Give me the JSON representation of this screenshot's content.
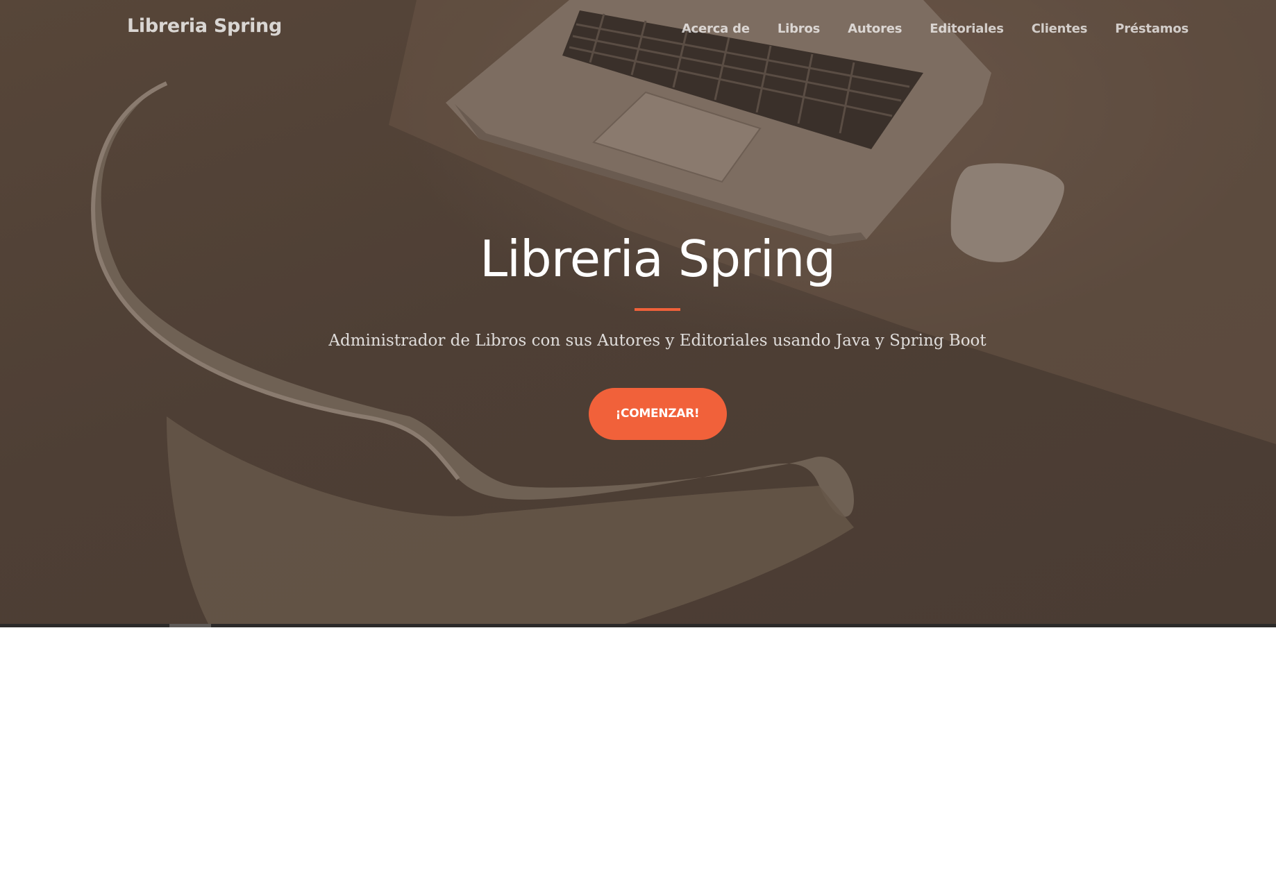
{
  "navbar": {
    "brand": "Libreria Spring",
    "links": [
      "Acerca de",
      "Libros",
      "Autores",
      "Editoriales",
      "Clientes",
      "Préstamos"
    ]
  },
  "hero": {
    "title": "Libreria Spring",
    "subtitle": "Administrador de Libros con sus Autores y Editoriales usando Java y Spring Boot",
    "cta_label": "¡COMENZAR!",
    "background_image": "laptop-mouse-chair-photo"
  },
  "colors": {
    "accent": "#f1613a",
    "hero_overlay": "#4e3f35",
    "page_background": "#ffffff"
  }
}
